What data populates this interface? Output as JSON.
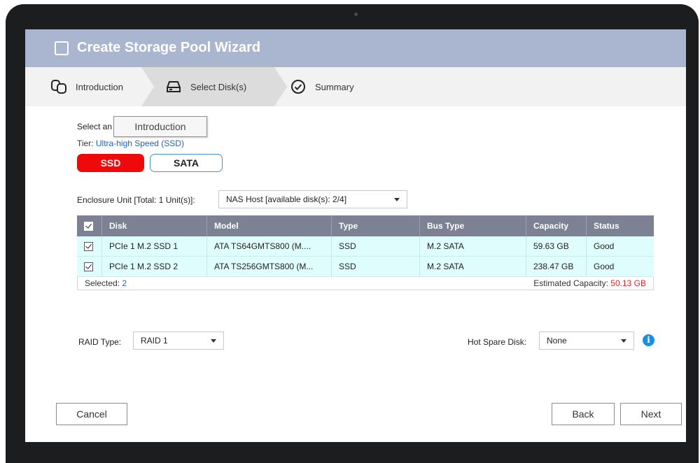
{
  "wizard": {
    "title": "Create Storage Pool Wizard",
    "steps": [
      {
        "label": "Introduction",
        "icon": "disks-icon"
      },
      {
        "label": "Select Disk(s)",
        "icon": "hard-drive-icon",
        "active": true
      },
      {
        "label": "Summary",
        "icon": "check-circle-icon"
      }
    ]
  },
  "content": {
    "select_prefix": "Select an",
    "tooltip": "Introduction",
    "tier_label": "Tier: ",
    "tier_value": "Ultra-high Speed (SSD)",
    "tabs": [
      {
        "label": "SSD",
        "selected": true
      },
      {
        "label": "SATA",
        "selected": false
      }
    ],
    "enclosure_label": "Enclosure Unit [Total: 1 Unit(s)]:",
    "enclosure_value": "NAS Host [available disk(s): 2/4]"
  },
  "table": {
    "columns": [
      "Disk",
      "Model",
      "Type",
      "Bus Type",
      "Capacity",
      "Status"
    ],
    "rows": [
      {
        "disk": "PCIe 1 M.2 SSD 1",
        "model": "ATA TS64GMTS800 (M....",
        "type": "SSD",
        "bus": "M.2 SATA",
        "capacity": "59.63 GB",
        "status": "Good",
        "checked": true
      },
      {
        "disk": "PCIe 1 M.2 SSD 2",
        "model": "ATA TS256GMTS800 (M...",
        "type": "SSD",
        "bus": "M.2 SATA",
        "capacity": "238.47 GB",
        "status": "Good",
        "checked": true
      }
    ],
    "selected_label": "Selected: ",
    "selected_count": "2",
    "estimated_label": "Estimated Capacity: ",
    "estimated_value": "50.13 GB"
  },
  "options": {
    "raid_label": "RAID Type:",
    "raid_value": "RAID 1",
    "hotspare_label": "Hot Spare Disk:",
    "hotspare_value": "None",
    "info_glyph": "i"
  },
  "footer": {
    "cancel": "Cancel",
    "back": "Back",
    "next": "Next"
  },
  "colors": {
    "titlebar": "#aab5d0",
    "accent_red": "#ee0a0a",
    "link_blue": "#1b62c4",
    "table_header": "#7c8294",
    "row_bg": "#dffdfd"
  }
}
